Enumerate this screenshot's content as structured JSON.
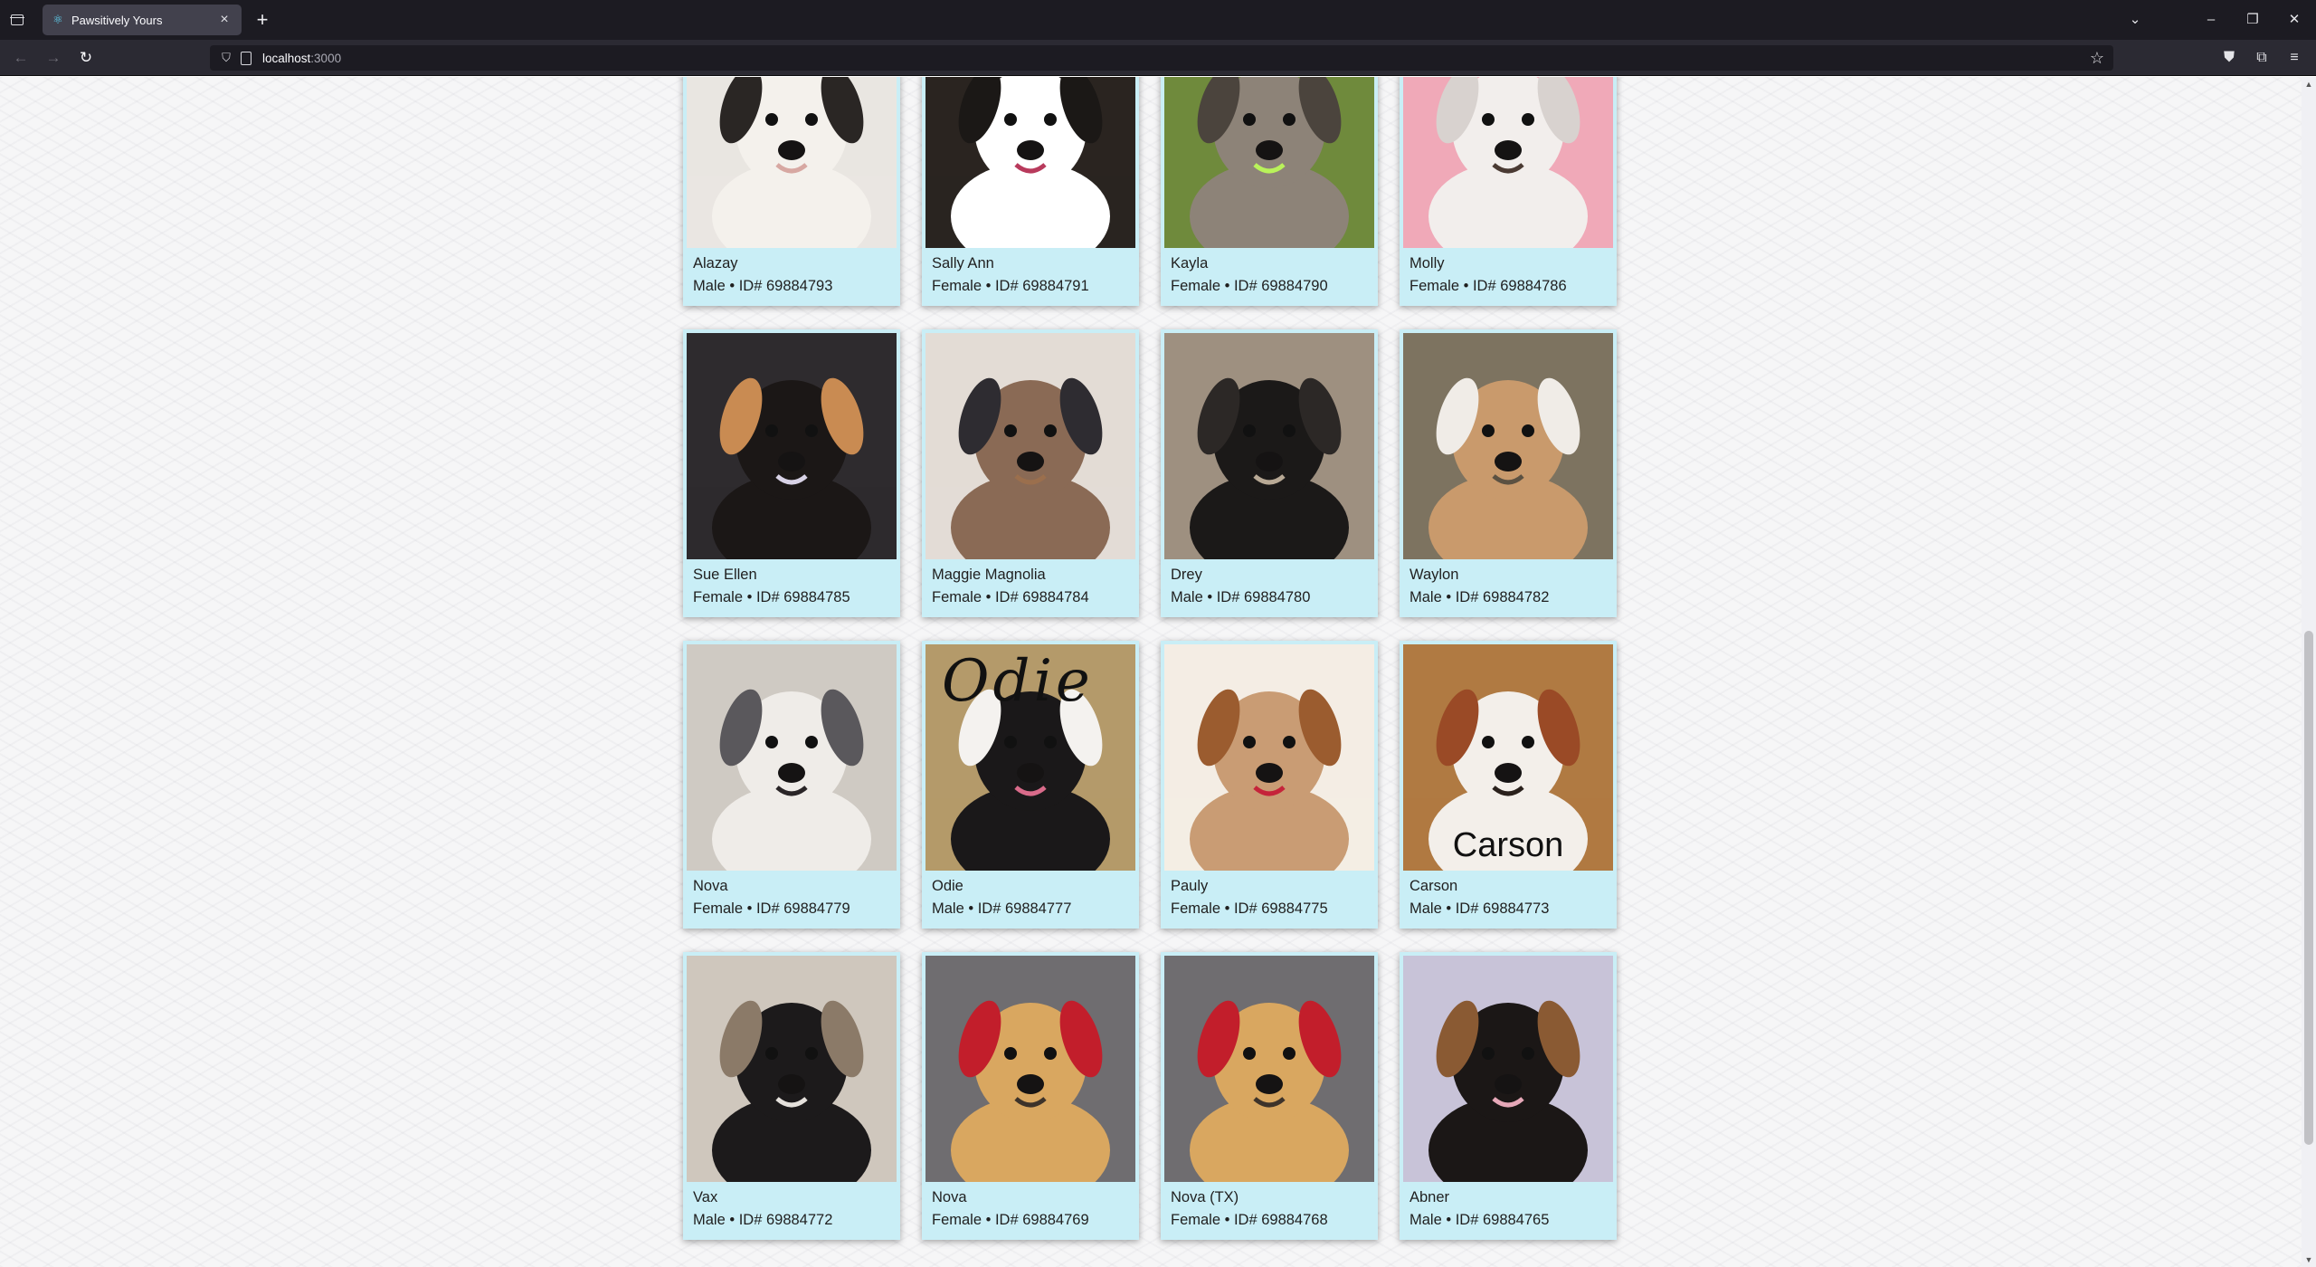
{
  "browser": {
    "tab_title": "Pawsitively Yours",
    "url_host": "localhost",
    "url_port": ":3000"
  },
  "dogs": [
    {
      "name": "Alazay",
      "meta": "Male • ID# 69884793",
      "palette": [
        "#e9e6e1",
        "#f4f1ec",
        "#2a2624",
        "#d7a8a2"
      ]
    },
    {
      "name": "Sally Ann",
      "meta": "Female • ID# 69884791",
      "palette": [
        "#2a2420",
        "#ffffff",
        "#1b1816",
        "#b83a5c"
      ]
    },
    {
      "name": "Kayla",
      "meta": "Female • ID# 69884790",
      "palette": [
        "#6f8a3c",
        "#8d8378",
        "#4b443d",
        "#b9f25a"
      ]
    },
    {
      "name": "Molly",
      "meta": "Female • ID# 69884786",
      "palette": [
        "#f0a9b8",
        "#f2eeec",
        "#d8d2cf",
        "#4a3a33"
      ]
    },
    {
      "name": "Sue Ellen",
      "meta": "Female • ID# 69884785",
      "palette": [
        "#2e2b2e",
        "#1b1716",
        "#c98b52",
        "#d8d2e6"
      ]
    },
    {
      "name": "Maggie Magnolia",
      "meta": "Female • ID# 69884784",
      "palette": [
        "#e3dcd5",
        "#8a6a55",
        "#2e2c31",
        "#9b6f4d"
      ]
    },
    {
      "name": "Drey",
      "meta": "Male • ID# 69884780",
      "palette": [
        "#9e9080",
        "#1b1918",
        "#2c2826",
        "#b8a995"
      ]
    },
    {
      "name": "Waylon",
      "meta": "Male • ID# 69884782",
      "palette": [
        "#7d7360",
        "#c99a6c",
        "#f0ece7",
        "#5b5142"
      ]
    },
    {
      "name": "Nova",
      "meta": "Female • ID# 69884779",
      "palette": [
        "#cfcac3",
        "#efece8",
        "#5a585c",
        "#2a2527"
      ]
    },
    {
      "name": "Odie",
      "meta": "Male • ID# 69884777",
      "palette": [
        "#b49a6a",
        "#1a1819",
        "#f4f2ef",
        "#d96b8a"
      ],
      "caption": "Odie"
    },
    {
      "name": "Pauly",
      "meta": "Female • ID# 69884775",
      "palette": [
        "#f4ede4",
        "#c99c74",
        "#9b5c2f",
        "#c5243a"
      ]
    },
    {
      "name": "Carson",
      "meta": "Male • ID# 69884773",
      "palette": [
        "#b07a42",
        "#f3efea",
        "#9a4a26",
        "#2a211c"
      ],
      "caption": "Carson"
    },
    {
      "name": "Vax",
      "meta": "Male • ID# 69884772",
      "palette": [
        "#cfc7bd",
        "#1c1a1b",
        "#8b7a68",
        "#e5e1dc"
      ]
    },
    {
      "name": "Nova",
      "meta": "Female • ID# 69884769",
      "palette": [
        "#6f6d70",
        "#d9a760",
        "#c21e2b",
        "#3d332a"
      ]
    },
    {
      "name": "Nova (TX)",
      "meta": "Female • ID# 69884768",
      "palette": [
        "#6f6d70",
        "#d9a760",
        "#c21e2b",
        "#3d332a"
      ]
    },
    {
      "name": "Abner",
      "meta": "Male • ID# 69884765",
      "palette": [
        "#c8c3d8",
        "#1b1716",
        "#8a5a33",
        "#e6a8b8"
      ]
    }
  ]
}
